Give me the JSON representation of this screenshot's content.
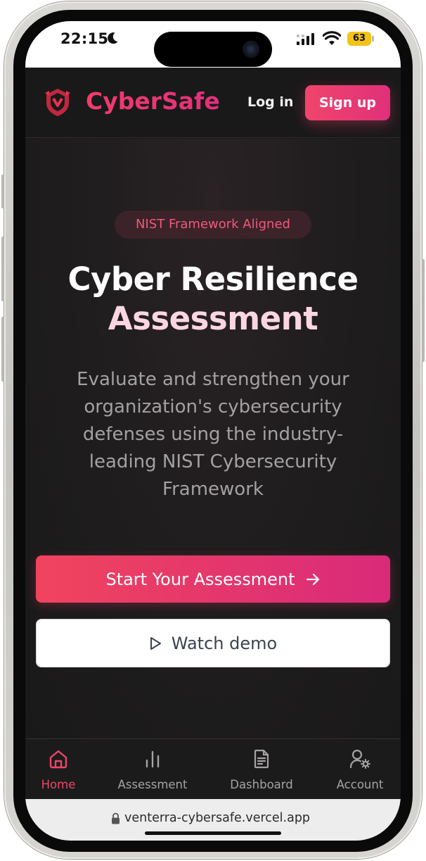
{
  "status_bar": {
    "time": "22:15",
    "battery": "63",
    "icons": [
      "moon-icon",
      "signal-icon",
      "wifi-icon",
      "battery-icon"
    ]
  },
  "header": {
    "brand": "CyberSafe",
    "login_label": "Log in",
    "signup_label": "Sign up"
  },
  "hero": {
    "badge": "NIST Framework Aligned",
    "title_line1": "Cyber Resilience",
    "title_line2": "Assessment",
    "description": "Evaluate and strengthen your organization's cybersecurity defenses using the industry-leading NIST Cybersecurity Framework",
    "cta_label": "Start Your Assessment",
    "demo_label": "Watch demo"
  },
  "tabs": [
    {
      "label": "Home",
      "icon": "home-icon",
      "active": true
    },
    {
      "label": "Assessment",
      "icon": "bar-chart-icon",
      "active": false
    },
    {
      "label": "Dashboard",
      "icon": "document-icon",
      "active": false
    },
    {
      "label": "Account",
      "icon": "user-settings-icon",
      "active": false
    }
  ],
  "browser": {
    "url": "venterra-cybersafe.vercel.app"
  },
  "colors": {
    "accent": "#ee4668",
    "background": "#1c1a1b",
    "title_accent": "#fbd6e2"
  }
}
